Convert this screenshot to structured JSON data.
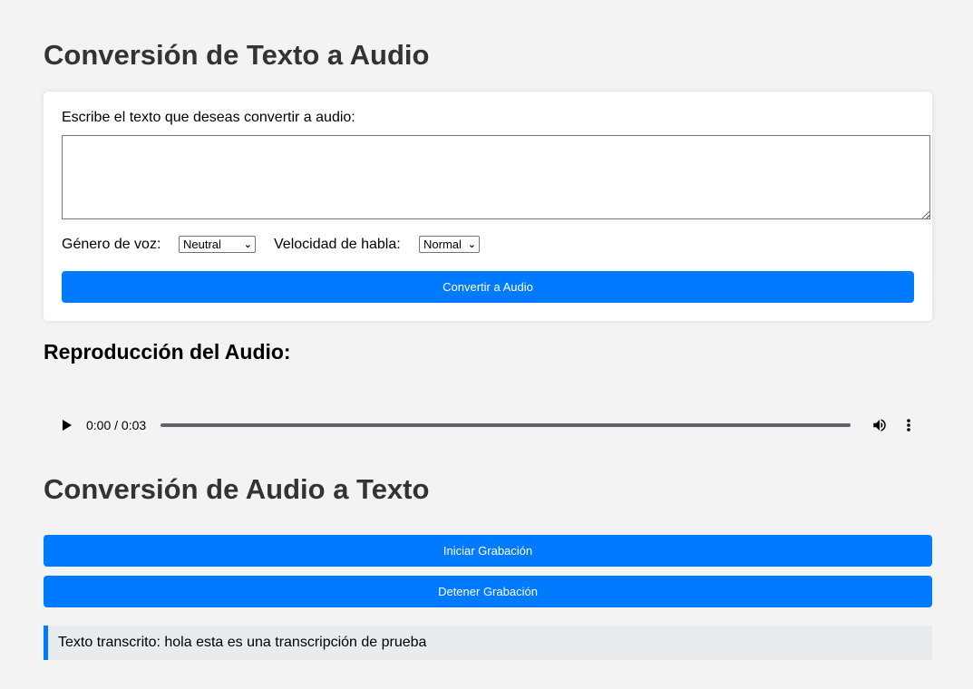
{
  "text_to_audio": {
    "title": "Conversión de Texto a Audio",
    "prompt_label": "Escribe el texto que deseas convertir a audio:",
    "text_value": "",
    "voice_gender_label": "Género de voz:",
    "voice_gender_selected": "Neutral",
    "speech_rate_label": "Velocidad de habla:",
    "speech_rate_selected": "Normal",
    "convert_button": "Convertir a Audio"
  },
  "playback": {
    "title": "Reproducción del Audio:",
    "time_display": "0:00 / 0:03",
    "progress_fraction": 0
  },
  "audio_to_text": {
    "title": "Conversión de Audio a Texto",
    "start_button": "Iniciar Grabación",
    "stop_button": "Detener Grabación",
    "result_text": "Texto transcrito: hola esta es una transcripción de prueba"
  },
  "colors": {
    "accent": "#007bff",
    "background": "#f3f3f3",
    "result_background": "#e9ecef"
  },
  "icons": {
    "play": "play-icon",
    "volume": "volume-icon",
    "more": "more-vert-icon",
    "dropdown": "chevron-down-icon"
  }
}
